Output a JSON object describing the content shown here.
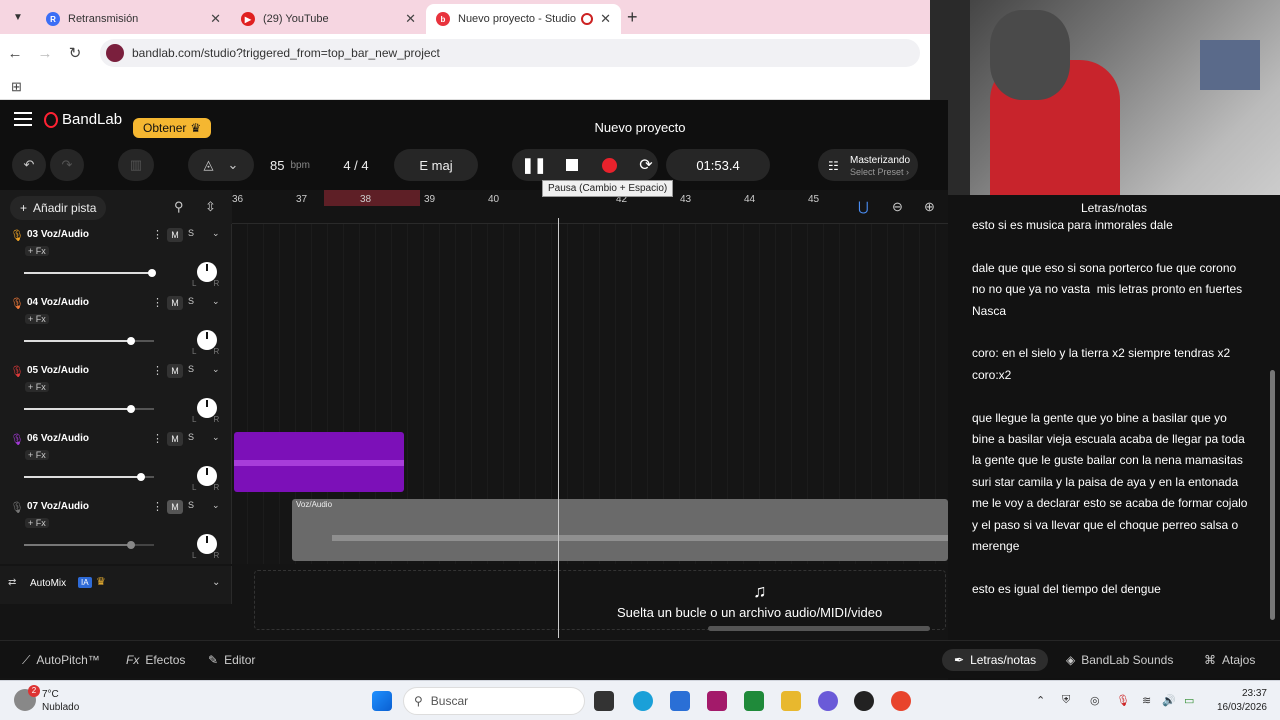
{
  "browser": {
    "tabs": [
      {
        "label": "Retransmisión",
        "fav_color": "#3b6ef5",
        "fav_letter": "R"
      },
      {
        "label": "(29) YouTube",
        "fav_color": "#e02020",
        "fav_letter": "▶"
      },
      {
        "label": "Nuevo proyecto - Studio",
        "fav_color": "#e8333d",
        "fav_letter": "b"
      }
    ],
    "url": "bandlab.com/studio?triggered_from=top_bar_new_project"
  },
  "header": {
    "logo": "BandLab",
    "get_button": "Obtener",
    "project_title": "Nuevo proyecto"
  },
  "transport": {
    "tempo": "85",
    "tempo_unit": "bpm",
    "time_sig": "4 / 4",
    "key": "E maj",
    "time": "01:53.4",
    "mastering_title": "Masterizando",
    "mastering_sub": "Select Preset",
    "pause_tooltip": "Pausa (Cambio + Espacio)"
  },
  "toolbar": {
    "add_track": "Añadir pista"
  },
  "ruler": {
    "ticks": [
      "36",
      "37",
      "38",
      "39",
      "40",
      "42",
      "43",
      "44",
      "45"
    ]
  },
  "tracks": [
    {
      "name": "03  Voz/Audio",
      "fx": "+ Fx",
      "mic_color": "#f5a623",
      "volume": 1.0
    },
    {
      "name": "04  Voz/Audio",
      "fx": "+ Fx",
      "mic_color": "#f27a3a",
      "volume": 0.82
    },
    {
      "name": "05  Voz/Audio",
      "fx": "+ Fx",
      "mic_color": "#e23a3a",
      "volume": 0.82
    },
    {
      "name": "06  Voz/Audio",
      "fx": "+ Fx",
      "mic_color": "#a53ad8",
      "volume": 0.9
    },
    {
      "name": "07  Voz/Audio",
      "fx": "+ Fx",
      "mic_color": "#777777",
      "volume": 0.82,
      "clip_label": "Voz/Audio"
    }
  ],
  "track_controls": {
    "mute": "M",
    "solo": "S",
    "left": "L",
    "right": "R"
  },
  "automix": {
    "label": "AutoMix",
    "badge": "IA"
  },
  "dropzone": {
    "text": "Suelta un bucle o un archivo audio/MIDI/video"
  },
  "bottom": {
    "autopitch": "AutoPitch™",
    "effects": "Efectos",
    "editor": "Editor",
    "lyrics": "Letras/notas",
    "sounds": "BandLab Sounds",
    "shortcuts": "Atajos"
  },
  "lyrics": {
    "title": "Letras/notas",
    "text": "esto si es musica para inmorales dale\n\ndale que que eso si sona porterco fue que corono no no que ya no vasta  mis letras pronto en fuertes Nasca\n\ncoro: en el sielo y la tierra x2 siempre tendras x2 coro:x2\n\nque llegue la gente que yo bine a basilar que yo bine a basilar vieja escuala acaba de llegar pa toda la gente que le guste bailar con la nena mamasitas suri star camila y la paisa de aya y en la entonada me le voy a declarar esto se acaba de formar cojalo y el paso si va llevar que el choque perreo salsa o merenge\n\nesto es igual del tiempo del dengue"
  },
  "taskbar": {
    "temp": "7°C",
    "weather": "Nublado",
    "weather_badge": "2",
    "search": "Buscar",
    "time": "23:37",
    "date": "16/03/2026"
  }
}
